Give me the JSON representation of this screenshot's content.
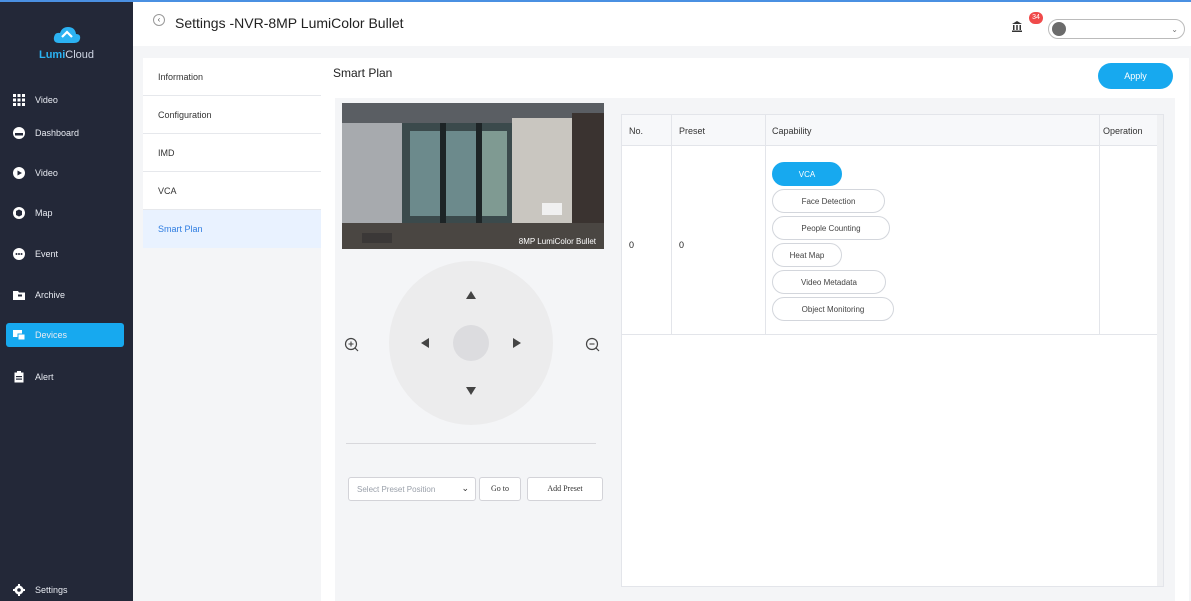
{
  "app": {
    "brand_prefix": "Lumi",
    "brand_suffix": "Cloud"
  },
  "sidebar": {
    "items": [
      {
        "label": "Video",
        "icon": "grid-icon",
        "active": false
      },
      {
        "label": "Dashboard",
        "icon": "dashboard-icon",
        "active": false
      },
      {
        "label": "Video",
        "icon": "play-icon",
        "active": false
      },
      {
        "label": "Map",
        "icon": "map-icon",
        "active": false
      },
      {
        "label": "Event",
        "icon": "event-icon",
        "active": false
      },
      {
        "label": "Archive",
        "icon": "archive-icon",
        "active": false
      },
      {
        "label": "Devices",
        "icon": "devices-icon",
        "active": true
      },
      {
        "label": "Alert",
        "icon": "alert-icon",
        "active": false
      }
    ],
    "settings_label": "Settings"
  },
  "header": {
    "title": "Settings -NVR-8MP LumiColor Bullet",
    "notification_count": "34"
  },
  "subnav": {
    "items": [
      {
        "label": "Information",
        "active": false
      },
      {
        "label": "Configuration",
        "active": false
      },
      {
        "label": "IMD",
        "active": false
      },
      {
        "label": "VCA",
        "active": false
      },
      {
        "label": "Smart Plan",
        "active": true
      }
    ]
  },
  "main": {
    "title": "Smart Plan",
    "apply_label": "Apply"
  },
  "camera": {
    "caption": "8MP LumiColor Bullet"
  },
  "preset": {
    "select_placeholder": "Select Preset Position",
    "goto_label": "Go to",
    "add_label": "Add Preset"
  },
  "table": {
    "headers": {
      "no": "No.",
      "preset": "Preset",
      "capability": "Capability",
      "operation": "Operation"
    },
    "rows": [
      {
        "no": "0",
        "preset": "0",
        "capabilities": [
          "VCA",
          "Face Detection",
          "People Counting",
          "Heat Map",
          "Video Metadata",
          "Object Monitoring"
        ],
        "active_capability": "VCA"
      }
    ]
  },
  "colors": {
    "accent": "#17a9ef",
    "sidebar_bg": "#232838",
    "badge": "#f04a4a"
  }
}
